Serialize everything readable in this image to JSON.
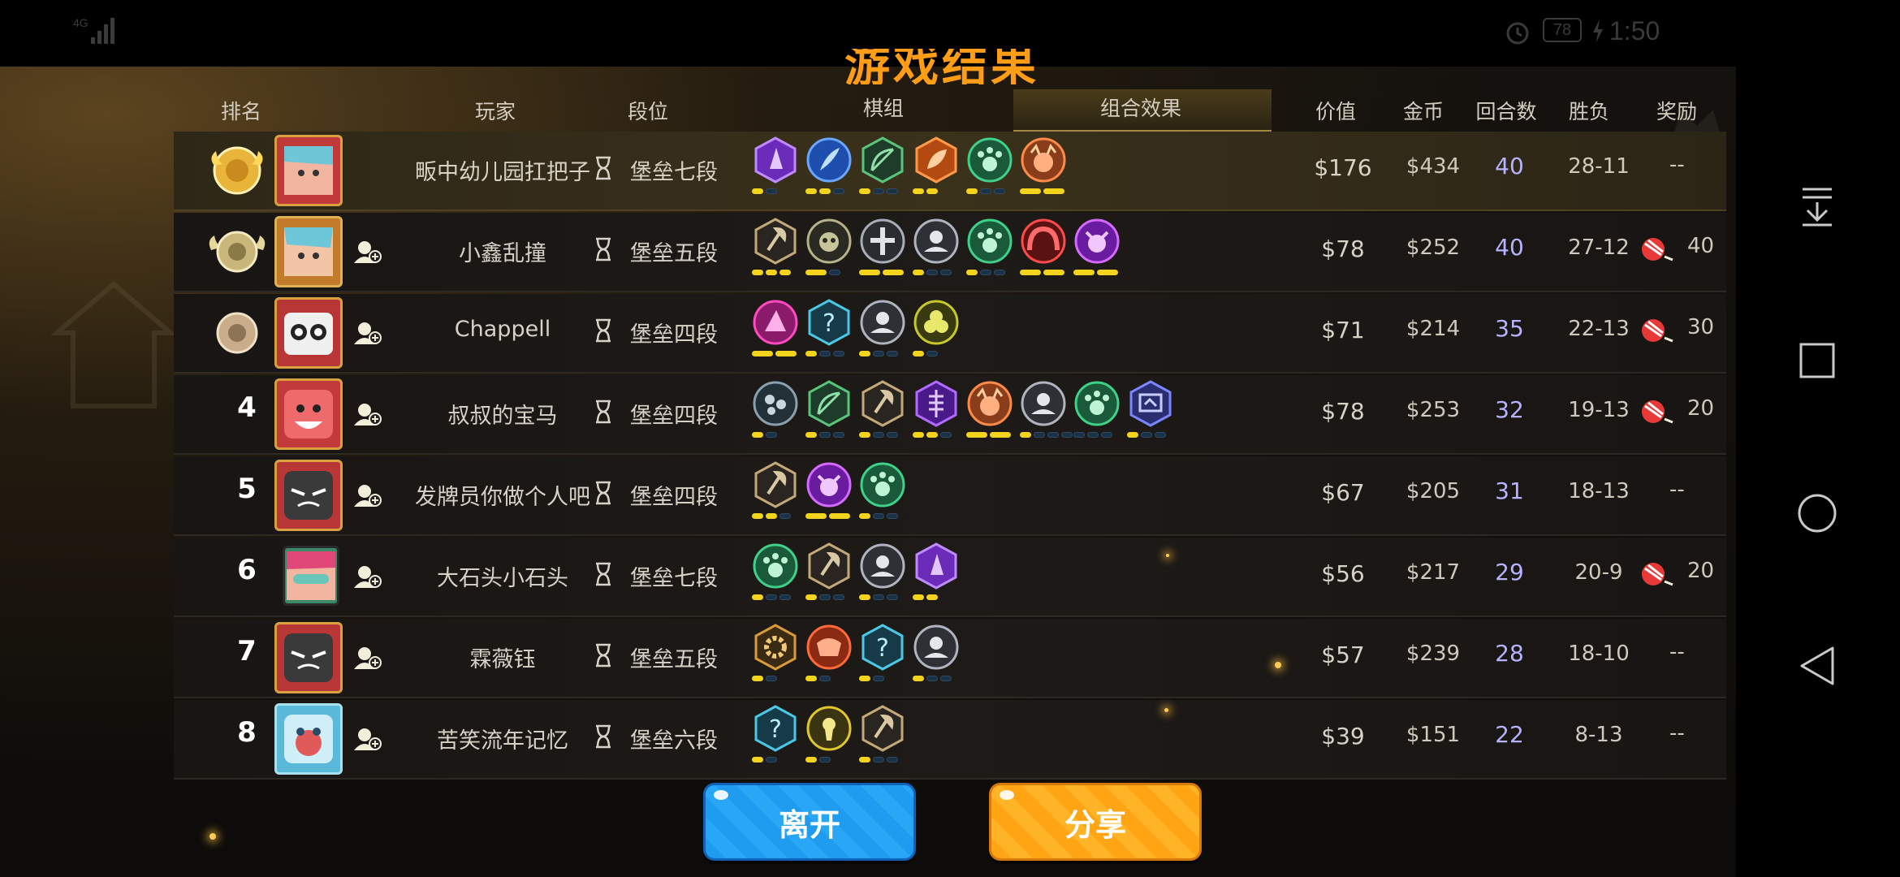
{
  "status_bar": {
    "signal": "4G",
    "battery": "78",
    "time": "1:50"
  },
  "title": "游戏结果",
  "columns": {
    "rank": "排名",
    "player": "玩家",
    "tier": "段位",
    "pieces": "棋组",
    "combo": "组合效果",
    "value": "价值",
    "gold": "金币",
    "rounds": "回合数",
    "winloss": "胜负",
    "reward": "奖励"
  },
  "rows": [
    {
      "rank": "1",
      "name": "畈中幼儿园扛把子",
      "tier": "堡垒七段",
      "value": "$176",
      "gold": "$434",
      "rounds": "40",
      "winloss": "28-11",
      "reward": "--"
    },
    {
      "rank": "2",
      "name": "小鑫乱撞",
      "tier": "堡垒五段",
      "value": "$78",
      "gold": "$252",
      "rounds": "40",
      "winloss": "27-12",
      "reward": "40"
    },
    {
      "rank": "3",
      "name": "Chappell",
      "tier": "堡垒四段",
      "value": "$71",
      "gold": "$214",
      "rounds": "35",
      "winloss": "22-13",
      "reward": "30"
    },
    {
      "rank": "4",
      "name": "叔叔的宝马",
      "tier": "堡垒四段",
      "value": "$78",
      "gold": "$253",
      "rounds": "32",
      "winloss": "19-13",
      "reward": "20"
    },
    {
      "rank": "5",
      "name": "发牌员你做个人吧",
      "tier": "堡垒四段",
      "value": "$67",
      "gold": "$205",
      "rounds": "31",
      "winloss": "18-13",
      "reward": "--"
    },
    {
      "rank": "6",
      "name": "大石头小石头",
      "tier": "堡垒七段",
      "value": "$56",
      "gold": "$217",
      "rounds": "29",
      "winloss": "20-9",
      "reward": "20"
    },
    {
      "rank": "7",
      "name": "霖薇钰",
      "tier": "堡垒五段",
      "value": "$57",
      "gold": "$239",
      "rounds": "28",
      "winloss": "18-10",
      "reward": "--"
    },
    {
      "rank": "8",
      "name": "苦笑流年记忆",
      "tier": "堡垒六段",
      "value": "$39",
      "gold": "$151",
      "rounds": "22",
      "winloss": "8-13",
      "reward": "--"
    }
  ],
  "buttons": {
    "leave": "离开",
    "share": "分享"
  }
}
